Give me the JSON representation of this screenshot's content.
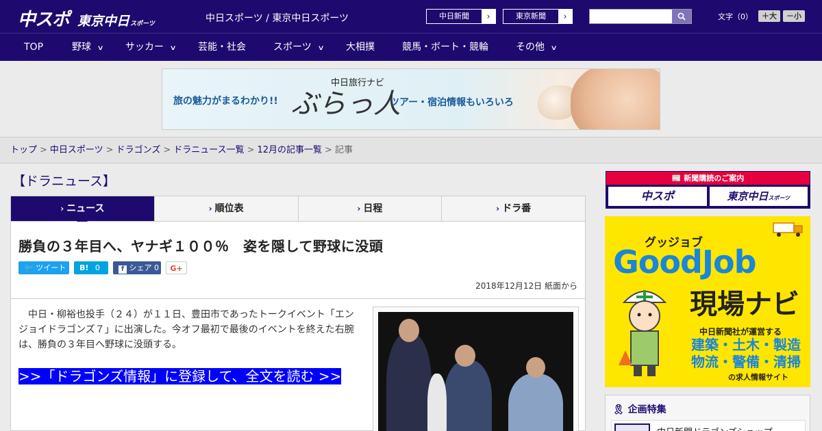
{
  "header": {
    "logo_main": "中スポ",
    "logo_tokyo": "東京中日",
    "logo_sports": "スポーツ",
    "site_title": "中日スポーツ / 東京中日スポーツ",
    "ext_links": [
      "中日新聞",
      "東京新聞"
    ],
    "search_placeholder": "",
    "font_label": "文字（0）",
    "font_bigger": "＋大",
    "font_smaller": "－小"
  },
  "nav": [
    {
      "label": "TOP",
      "dropdown": false
    },
    {
      "label": "野球",
      "dropdown": true
    },
    {
      "label": "サッカー",
      "dropdown": true
    },
    {
      "label": "芸能・社会",
      "dropdown": false
    },
    {
      "label": "スポーツ",
      "dropdown": true
    },
    {
      "label": "大相撲",
      "dropdown": false
    },
    {
      "label": "競馬・ボート・競輪",
      "dropdown": false
    },
    {
      "label": "その他",
      "dropdown": true
    }
  ],
  "ad_banner": {
    "sub": "中日旅行ナビ",
    "left": "旅の魅力がまるわかり!!",
    "main": "ぶらっ人",
    "right": "ツアー・宿泊情報もいろいろ"
  },
  "breadcrumb": {
    "links": [
      "トップ",
      "中日スポーツ",
      "ドラゴンズ",
      "ドラニュース一覧",
      "12月の記事一覧"
    ],
    "current": "記事",
    "separator": ">"
  },
  "section_title": "【ドラニュース】",
  "tabs": [
    "ニュース",
    "順位表",
    "日程",
    "ドラ番"
  ],
  "article": {
    "headline": "勝負の３年目へ、ヤナギ１００％　姿を隠して野球に没頭",
    "share": {
      "tweet": "ツイート",
      "hatena": "B!",
      "hatena_count": "0",
      "fb": "シェア",
      "fb_count": "0",
      "gplus": "G+"
    },
    "date": "2018年12月12日 紙面から",
    "lead": "　中日・柳裕也投手（２４）が１１日、豊田市であったトークイベント「エンジョイドラゴンズ７」に出演した。今オフ最初で最後のイベントを終えた右腕は、勝負の３年目へ野球に没頭する。",
    "cta": ">>「ドラゴンズ情報」に登録して、全文を読む >>"
  },
  "sidebar": {
    "subscribe_head": "新聞購読のご案内",
    "subscribe_a": "中スポ",
    "subscribe_b": "東京中日",
    "subscribe_b_small": "スポーツ",
    "job": {
      "kata": "グッジョブ",
      "good": "GoodJob",
      "navi": "現場ナビ",
      "line": "中日新聞社が運営する",
      "cats1": "建築・土木・製造",
      "cats2": "物流・警備・清掃",
      "foot": "の求人情報サイト"
    },
    "special_title": "企画特集",
    "special_item": "中日新聞ドラゴンズショップ"
  },
  "colors": {
    "brand": "#1e0a6e",
    "cta": "#0000ff",
    "red": "#e6003e",
    "job_yellow": "#ffe600"
  }
}
